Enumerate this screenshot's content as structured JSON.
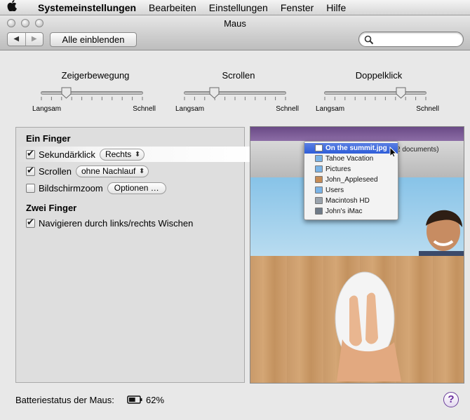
{
  "menubar": {
    "apple": "",
    "app_name": "Systemeinstellungen",
    "items": [
      "Bearbeiten",
      "Einstellungen",
      "Fenster",
      "Hilfe"
    ]
  },
  "window": {
    "title": "Maus",
    "show_all": "Alle einblenden",
    "search_value": ""
  },
  "sliders": [
    {
      "title": "Zeigerbewegung",
      "min_label": "Langsam",
      "max_label": "Schnell",
      "level": 0.25
    },
    {
      "title": "Scrollen",
      "min_label": "Langsam",
      "max_label": "Schnell",
      "level": 0.3
    },
    {
      "title": "Doppelklick",
      "min_label": "Langsam",
      "max_label": "Schnell",
      "level": 0.75
    }
  ],
  "panel": {
    "one_finger_heading": "Ein Finger",
    "secondary_click": {
      "label": "Sekundärklick",
      "checked": true,
      "popup_value": "Rechts"
    },
    "scrolling": {
      "label": "Scrollen",
      "checked": true,
      "popup_value": "ohne Nachlauf"
    },
    "screen_zoom": {
      "label": "Bildschirmzoom",
      "checked": false,
      "button": "Optionen …"
    },
    "two_finger_heading": "Zwei Finger",
    "swipe_nav": {
      "label": "Navigieren durch links/rechts Wischen",
      "checked": true
    }
  },
  "preview": {
    "docs_text": "2 documents)",
    "popup_items": [
      {
        "label": "On the summit.jpg",
        "icon": "image-file-icon",
        "selected": true
      },
      {
        "label": "Tahoe Vacation",
        "icon": "folder-icon"
      },
      {
        "label": "Pictures",
        "icon": "folder-icon"
      },
      {
        "label": "John_Appleseed",
        "icon": "home-icon"
      },
      {
        "label": "Users",
        "icon": "folder-icon"
      },
      {
        "label": "Macintosh HD",
        "icon": "hard-disk-icon"
      },
      {
        "label": "John's iMac",
        "icon": "computer-icon"
      }
    ]
  },
  "footer": {
    "battery_label": "Batteriestatus der Maus:",
    "battery_percent": "62%",
    "battery_level": 0.62,
    "help": "?"
  },
  "colors": {
    "selection": "#2e5dd8",
    "help_purple": "#6a2d9e"
  }
}
